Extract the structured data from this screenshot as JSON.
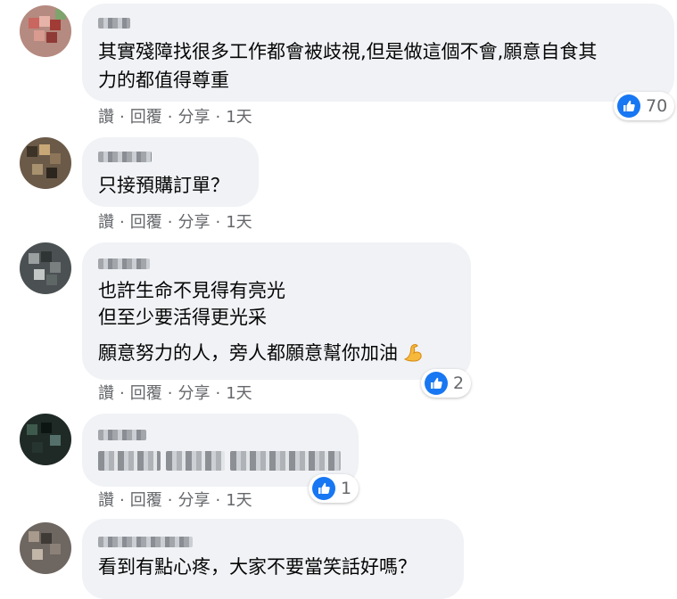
{
  "comments": [
    {
      "lines": [
        "其實殘障找很多工作都會被歧視,但是做這個不會,願意自食其",
        "力的都值得尊重"
      ],
      "actions": {
        "like": "讚",
        "reply": "回覆",
        "share": "分享",
        "time": "1天"
      },
      "reaction_count": "70"
    },
    {
      "lines": [
        "只接預購訂單？"
      ],
      "actions": {
        "like": "讚",
        "reply": "回覆",
        "share": "分享",
        "time": "1天"
      }
    },
    {
      "lines": [
        "也許生命不見得有亮光",
        "但至少要活得更光采",
        "願意努力的人，旁人都願意幫你加油"
      ],
      "emoji": "flexed-biceps",
      "actions": {
        "like": "讚",
        "reply": "回覆",
        "share": "分享",
        "time": "1天"
      },
      "reaction_count": "2"
    },
    {
      "actions": {
        "like": "讚",
        "reply": "回覆",
        "share": "分享",
        "time": "1天"
      },
      "reaction_count": "1"
    },
    {
      "lines": [
        "看到有點心疼，大家不要當笑話好嗎？"
      ]
    }
  ],
  "icons": {
    "reaction": "like-icon",
    "emoji": "flexed-biceps-icon"
  },
  "colors": {
    "bubble": "#f0f2f5",
    "like_blue": "#1877f2",
    "meta_text": "#65676b"
  }
}
